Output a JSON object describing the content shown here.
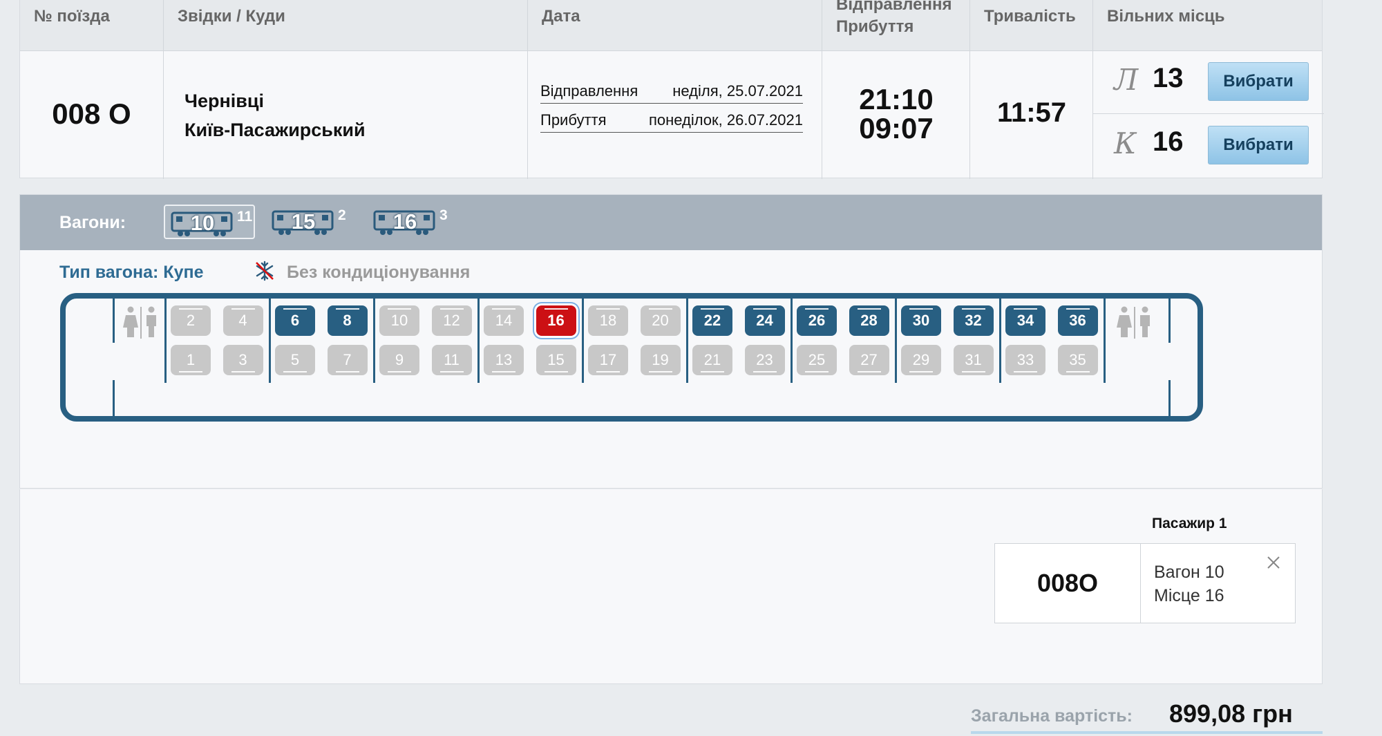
{
  "table": {
    "headers": {
      "train_no": "№ поїзда",
      "route": "Звідки / Куди",
      "date": "Дата",
      "times_top": "Відправлення",
      "times_bottom": "Прибуття",
      "duration": "Тривалість",
      "free": "Вільних місць"
    },
    "row": {
      "train_no": "008 О",
      "from": "Чернівці",
      "to": "Київ-Пасажирський",
      "depart_label": "Відправлення",
      "depart_date": "неділя, 25.07.2021",
      "arrive_label": "Прибуття",
      "arrive_date": "понеділок, 26.07.2021",
      "depart_time": "21:10",
      "arrive_time": "09:07",
      "duration": "11:57",
      "classes": [
        {
          "code": "Л",
          "count": "13",
          "button": "Вибрати"
        },
        {
          "code": "К",
          "count": "16",
          "button": "Вибрати"
        }
      ]
    }
  },
  "wagons": {
    "label": "Вагони:",
    "tabs": [
      {
        "number": "10",
        "free": "11",
        "active": true
      },
      {
        "number": "15",
        "free": "2",
        "active": false
      },
      {
        "number": "16",
        "free": "3",
        "active": false
      }
    ],
    "type_line": "Тип вагона: Купе",
    "ac_icon": "snowflake-crossed-icon",
    "ac_text": "Без кондиціонування",
    "upper_seats": [
      "2",
      "4",
      "6",
      "8",
      "10",
      "12",
      "14",
      "16",
      "18",
      "20",
      "22",
      "24",
      "26",
      "28",
      "30",
      "32",
      "34",
      "36"
    ],
    "lower_seats": [
      "1",
      "3",
      "5",
      "7",
      "9",
      "11",
      "13",
      "15",
      "17",
      "19",
      "21",
      "23",
      "25",
      "27",
      "29",
      "31",
      "33",
      "35"
    ],
    "available": [
      "6",
      "8",
      "22",
      "24",
      "26",
      "28",
      "30",
      "32",
      "34",
      "36"
    ],
    "selected": "16",
    "colors": {
      "free": "#285f82",
      "selected": "#cc1014",
      "taken": "#c8c8c8"
    }
  },
  "passenger": {
    "title": "Пасажир 1",
    "train": "008О",
    "wagon": "Вагон 10",
    "seat": "Місце 16"
  },
  "total": {
    "label": "Загальна вартість:",
    "value": "899,08 грн"
  }
}
